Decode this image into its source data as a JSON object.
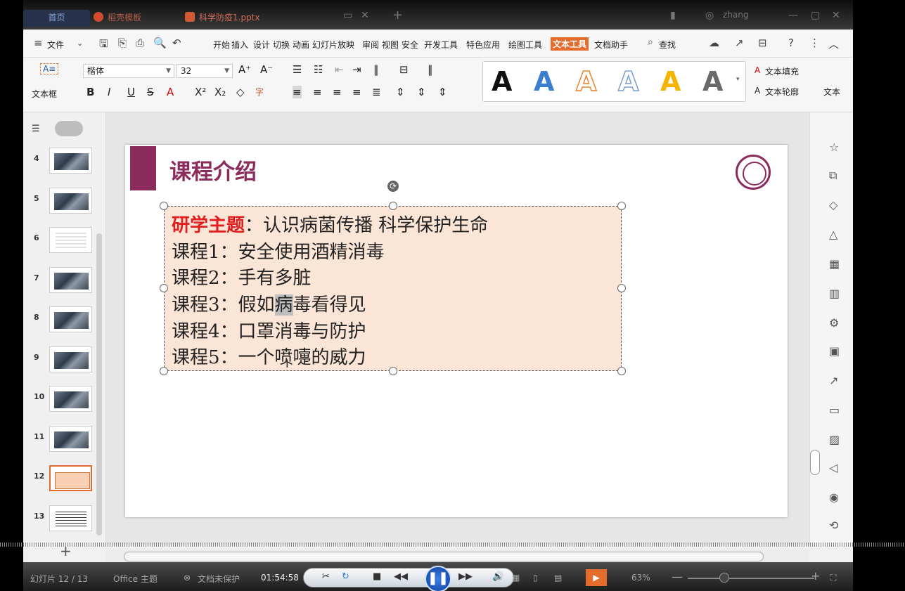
{
  "titlebar": {
    "tabs": [
      {
        "label": "首页"
      },
      {
        "label": "稻壳模板"
      },
      {
        "label": "科学防疫1.pptx"
      }
    ],
    "user": "zhang"
  },
  "menubar": {
    "file": "文件",
    "items": [
      "开始",
      "插入",
      "设计",
      "切换",
      "动画",
      "幻灯片放映",
      "审阅",
      "视图",
      "安全",
      "开发工具",
      "特色应用",
      "绘图工具",
      "文本工具",
      "文档助手"
    ],
    "search": "查找"
  },
  "ribbon": {
    "textbox_label": "文本框",
    "font_name": "楷体",
    "font_size": "32",
    "text_fill": "文本填充",
    "text_outline": "文本轮廓",
    "text_effect": "文本",
    "style_colors": [
      "#111111",
      "#3a7fd0",
      "#e8852e",
      "#7a9fd0",
      "#f4b400",
      "#6a6a6a"
    ]
  },
  "slides": {
    "numbers": [
      "4",
      "5",
      "6",
      "7",
      "8",
      "9",
      "10",
      "11",
      "12",
      "13"
    ],
    "active": "12"
  },
  "slide": {
    "title": "课程介绍",
    "topic_label": "研学主题",
    "topic_text": "：认识病菌传播 科学保护生命",
    "courses": [
      "课程1：安全使用酒精消毒",
      "课程2：手有多脏",
      "课程3：假如",
      "课程4：口罩消毒与防护",
      "课程5：一个喷嚏的威力"
    ],
    "course3_hl": "病",
    "course3_rest": "毒看得见"
  },
  "status": {
    "slide_info": "幻灯片 12 / 13",
    "theme": "Office 主题",
    "protect": "文档未保护",
    "time": "01:54:58",
    "zoom": "63%"
  }
}
